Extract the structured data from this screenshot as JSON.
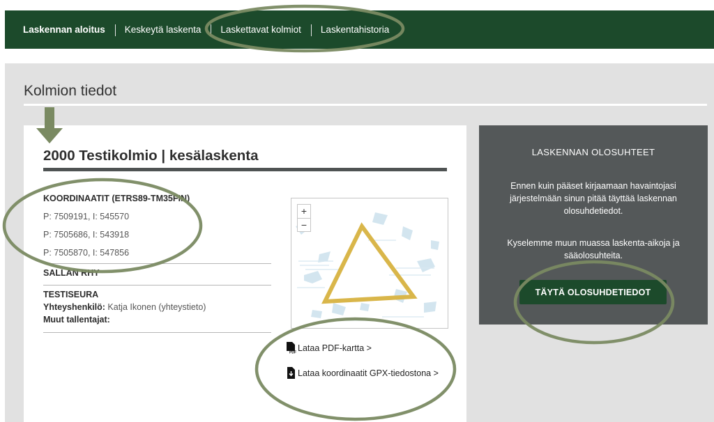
{
  "nav": {
    "items": [
      {
        "label": "Laskennan aloitus"
      },
      {
        "label": "Keskeytä laskenta"
      },
      {
        "label": "Laskettavat kolmiot"
      },
      {
        "label": "Laskentahistoria"
      }
    ]
  },
  "section": {
    "title": "Kolmion tiedot"
  },
  "card": {
    "title": "2000 Testikolmio | kesälaskenta",
    "coordinates_heading": "KOORDINAATIT (ETRS89-TM35FIN)",
    "coordinates": [
      "P: 7509191, I: 545570",
      "P: 7505686, I: 543918",
      "P: 7505870, I: 547856"
    ],
    "association": "SALLAN RHY",
    "club": "TESTISEURA",
    "contact_label": "Yhteyshenkilö:",
    "contact_value": "Katja Ikonen (yhteystieto)",
    "others_label": "Muut tallentajat:",
    "map": {
      "zoom_in": "+",
      "zoom_out": "−"
    },
    "downloads": {
      "pdf": "Lataa PDF-kartta >",
      "gpx": "Lataa koordinaatit GPX-tiedostona >"
    }
  },
  "side_panel": {
    "title": "LASKENNAN OLOSUHTEET",
    "text1": "Ennen kuin pääset kirjaamaan havaintojasi järjestelmään sinun pitää täyttää laskennan olosuhdetiedot.",
    "text2": "Kyselemme muun muassa laskenta-aikoja ja sääolosuhteita.",
    "button": "TÄYTÄ OLOSUHDETIEDOT"
  },
  "colors": {
    "nav_bg": "#1c4a2b",
    "content_bg": "#e1e1e1",
    "panel_bg": "#545859",
    "triangle": "#d9b64a",
    "annotation": "#7a8a62"
  }
}
